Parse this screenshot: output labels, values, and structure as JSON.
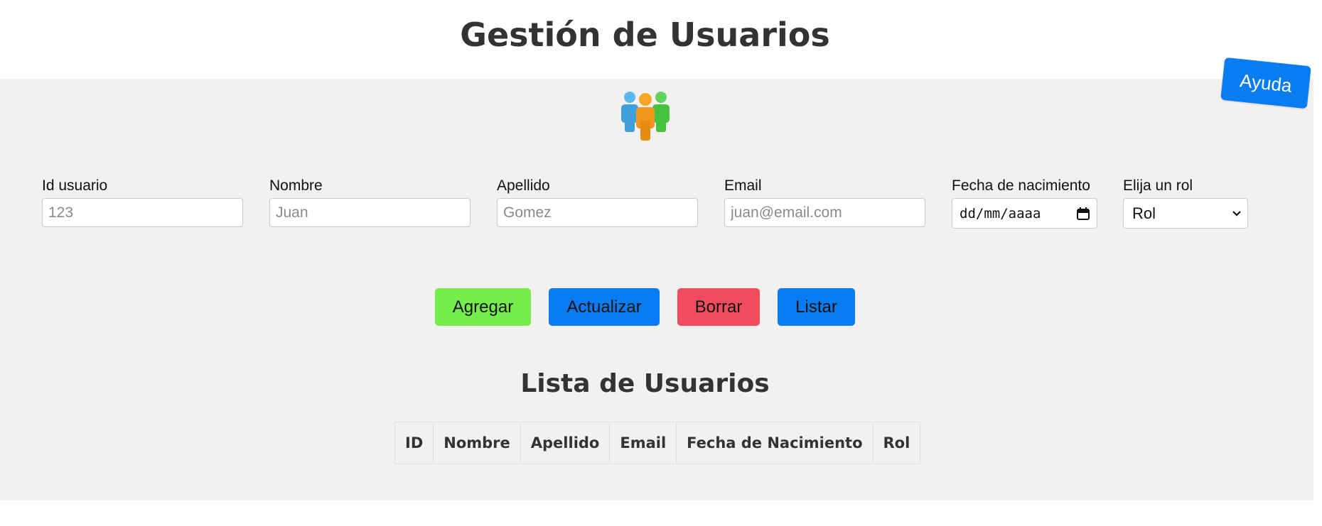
{
  "header": {
    "title": "Gestión de Usuarios",
    "help_label": "Ayuda"
  },
  "icons": {
    "users": "users-group-icon",
    "calendar": "calendar-icon",
    "dropdown": "chevron-down-icon"
  },
  "form": {
    "id": {
      "label": "Id usuario",
      "placeholder": "123"
    },
    "nombre": {
      "label": "Nombre",
      "placeholder": "Juan"
    },
    "apellido": {
      "label": "Apellido",
      "placeholder": "Gomez"
    },
    "email": {
      "label": "Email",
      "placeholder": "juan@email.com"
    },
    "fecha": {
      "label": "Fecha de nacimiento",
      "value": "dd/mm/aaaa"
    },
    "rol": {
      "label": "Elija un rol",
      "selected": "Rol"
    }
  },
  "actions": {
    "add": "Agregar",
    "update": "Actualizar",
    "delete": "Borrar",
    "list": "Listar"
  },
  "list": {
    "title": "Lista de Usuarios",
    "columns": [
      "ID",
      "Nombre",
      "Apellido",
      "Email",
      "Fecha de Nacimiento",
      "Rol"
    ],
    "rows": []
  },
  "colors": {
    "panel_bg": "#f3f0f0",
    "add_button": "#74ee4a",
    "update_button": "#0a7cf2",
    "delete_button": "#f04c5e",
    "list_button": "#0a7cf2",
    "help_button": "#0a7cf2",
    "title_text": "#333333"
  }
}
